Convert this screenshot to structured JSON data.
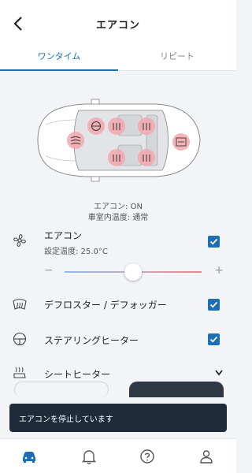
{
  "header": {
    "title": "エアコン"
  },
  "tabs": [
    {
      "label": "ワンタイム",
      "active": true
    },
    {
      "label": "リピート",
      "active": false
    }
  ],
  "status": {
    "ac_line": "エアコン: ON",
    "temp_line": "車室内温度: 通常"
  },
  "aircon": {
    "label": "エアコン",
    "setting": "設定温度: 25.0°C",
    "checked": true,
    "slider_level": 0.5,
    "minus": "−",
    "plus": "+"
  },
  "defrost": {
    "label": "デフロスター / デフォッガー",
    "checked": true
  },
  "steering": {
    "label": "ステアリングヒーター",
    "checked": true
  },
  "seat": {
    "label": "シートヒーター"
  },
  "toast": {
    "message": "エアコンを停止しています"
  },
  "colors": {
    "accent": "#1a6fb5",
    "heater": "#f2a7ad",
    "toast_bg": "#1f2a3a"
  },
  "icons": {
    "back": "chevron-left-icon",
    "fan": "fan-icon",
    "defrost": "defrost-icon",
    "steering": "steering-heat-icon",
    "seat": "seat-heat-icon",
    "nav": [
      "car-icon",
      "bell-icon",
      "help-icon",
      "user-icon"
    ]
  }
}
